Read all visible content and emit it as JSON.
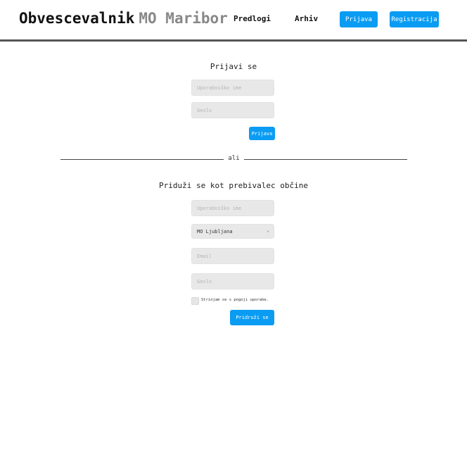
{
  "header": {
    "brand_main": "Obvescevalnik",
    "brand_city": "MO Maribor",
    "nav": {
      "predlogi": "Predlogi",
      "arhiv": "Arhiv"
    },
    "login_button": "Prijava",
    "register_button": "Registracija"
  },
  "login_form": {
    "title": "Prijavi se",
    "username_placeholder": "Uporabniško ime",
    "password_placeholder": "Geslo",
    "submit_label": "Prijava"
  },
  "divider": {
    "text": "ali"
  },
  "join_form": {
    "title": "Priduži se kot prebivalec občine",
    "username_placeholder": "Uporabniško ime",
    "municipality_selected": "MO Ljubljana",
    "email_placeholder": "Email",
    "password_placeholder": "Geslo",
    "terms_label": "Strinjam se s pogoji uporabe.",
    "submit_label": "Pridruži se"
  },
  "colors": {
    "accent": "#0a9cf2",
    "header_border": "#555555",
    "field_bg": "#e8e8e8"
  },
  "icons": {
    "select_chevron": "chevron-down-icon"
  }
}
